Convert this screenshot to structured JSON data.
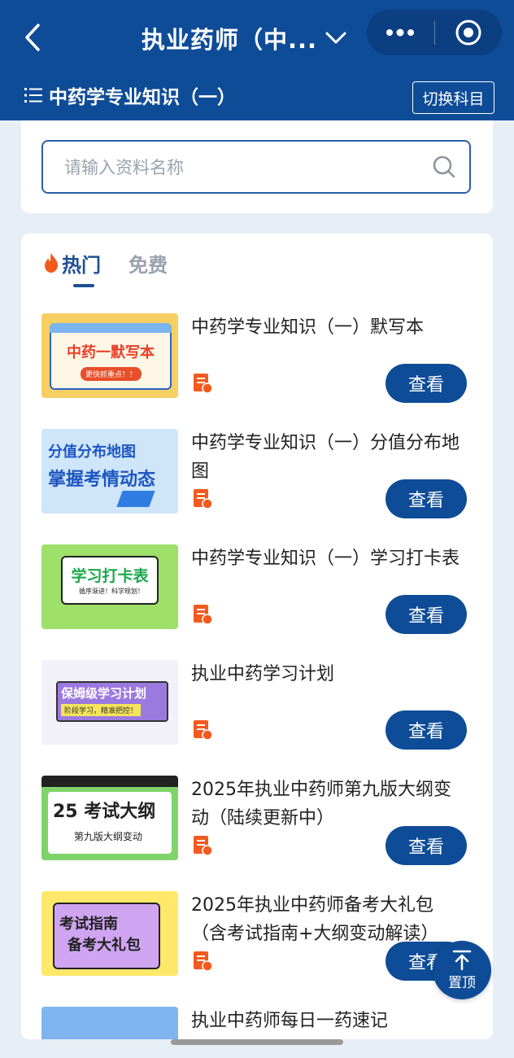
{
  "header": {
    "title": "执业药师（中...",
    "subject": "中药学专业知识（一）",
    "switch_label": "切换科目"
  },
  "search": {
    "placeholder": "请输入资料名称"
  },
  "tabs": [
    {
      "label": "热门",
      "active": true
    },
    {
      "label": "免费",
      "active": false
    }
  ],
  "items": [
    {
      "title": "中药学专业知识（一）默写本",
      "thumb_text": "中药一默写本",
      "thumb_sub": "更快抓重点！！",
      "button": "查看"
    },
    {
      "title": "中药学专业知识（一）分值分布地图",
      "thumb_text": "分值分布地图",
      "thumb_sub": "掌握考情动态",
      "button": "查看"
    },
    {
      "title": "中药学专业知识（一）学习打卡表",
      "thumb_text": "学习打卡表",
      "thumb_sub": "循序渐进！科学规划！",
      "button": "查看"
    },
    {
      "title": "执业中药学习计划",
      "thumb_text": "保姆级学习计划",
      "thumb_sub": "阶段学习，精准把控！",
      "button": "查看"
    },
    {
      "title": "2025年执业中药师第九版大纲变动（陆续更新中）",
      "thumb_text": "25 考试大纲",
      "thumb_sub": "第九版大纲变动",
      "button": "查看"
    },
    {
      "title": "2025年执业中药师备考大礼包（含考试指南+大纲变动解读）",
      "thumb_text": "考试指南",
      "thumb_sub": "备考大礼包",
      "button": "查看"
    },
    {
      "title": "执业中药师每日一药速记",
      "thumb_text": "",
      "thumb_sub": "",
      "button": ""
    }
  ],
  "back_top_label": "置顶",
  "colors": {
    "primary": "#0f4c97",
    "accent": "#f25a1e"
  }
}
